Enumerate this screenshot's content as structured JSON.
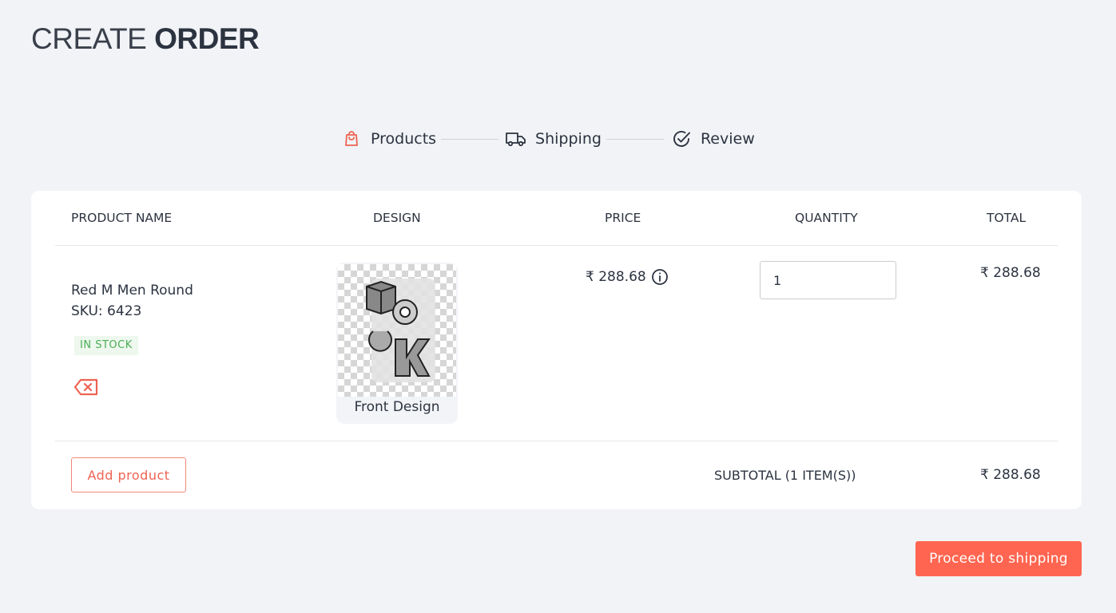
{
  "page": {
    "title_light": "CREATE",
    "title_bold": "ORDER"
  },
  "stepper": {
    "steps": [
      {
        "label": "Products",
        "icon": "shopping-bag-icon",
        "active": true
      },
      {
        "label": "Shipping",
        "icon": "truck-icon",
        "active": false
      },
      {
        "label": "Review",
        "icon": "check-circle-icon",
        "active": false
      }
    ]
  },
  "table": {
    "headers": {
      "product_name": "PRODUCT NAME",
      "design": "DESIGN",
      "price": "PRICE",
      "quantity": "QUANTITY",
      "total": "TOTAL"
    },
    "rows": [
      {
        "product_name": "Red M Men Round",
        "sku": "SKU: 6423",
        "stock_status": "IN STOCK",
        "design_caption": "Front Design",
        "price": "₹ 288.68",
        "quantity": "1",
        "total": "₹ 288.68"
      }
    ]
  },
  "footer": {
    "add_product_label": "Add product",
    "subtotal_label": "SUBTOTAL (1 ITEM(S))",
    "subtotal_value": "₹ 288.68"
  },
  "actions": {
    "proceed_label": "Proceed to shipping"
  },
  "colors": {
    "accent": "#ff6550",
    "stock_green": "#4bad55",
    "background": "#f1f3f6"
  }
}
